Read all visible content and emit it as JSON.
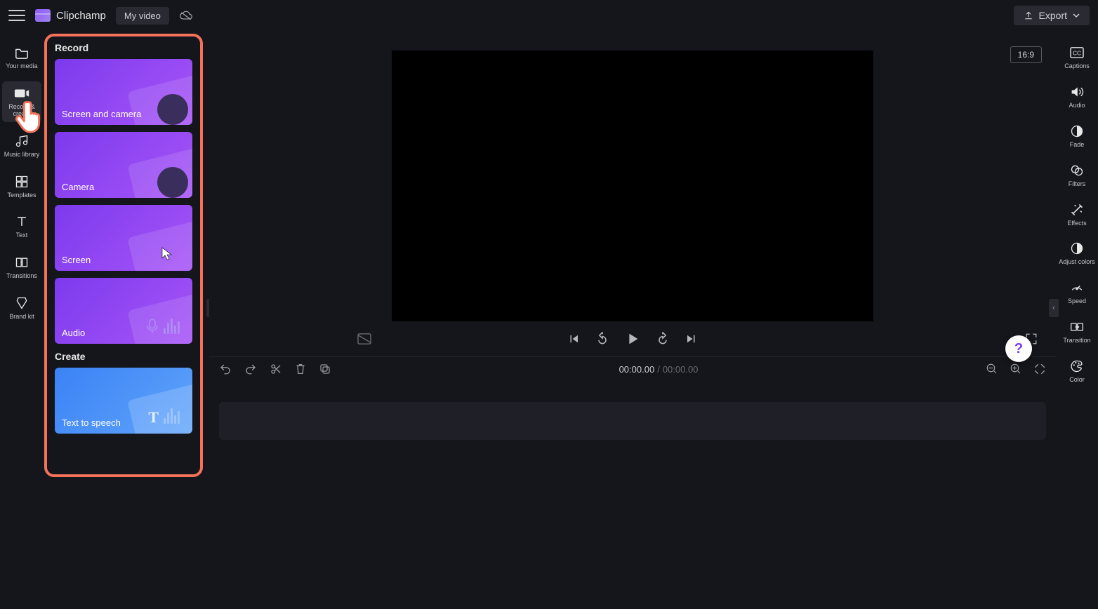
{
  "header": {
    "brand": "Clipchamp",
    "project": "My video",
    "export": "Export"
  },
  "left_rail": [
    {
      "label": "Your media",
      "icon": "folder"
    },
    {
      "label": "Record & create",
      "icon": "camera",
      "active": true
    },
    {
      "label": "Music library",
      "icon": "music"
    },
    {
      "label": "Templates",
      "icon": "templates"
    },
    {
      "label": "Text",
      "icon": "text"
    },
    {
      "label": "Transitions",
      "icon": "transitions"
    },
    {
      "label": "Brand kit",
      "icon": "brandkit"
    }
  ],
  "panel": {
    "section_record": "Record",
    "section_create": "Create",
    "cards": {
      "screen_camera": "Screen and camera",
      "camera": "Camera",
      "screen": "Screen",
      "audio": "Audio",
      "tts": "Text to speech"
    }
  },
  "preview": {
    "aspect": "16:9"
  },
  "timecode": {
    "current": "00:00.00",
    "total": "00:00.00"
  },
  "right_rail": [
    {
      "label": "Captions",
      "icon": "captions"
    },
    {
      "label": "Audio",
      "icon": "audio"
    },
    {
      "label": "Fade",
      "icon": "fade"
    },
    {
      "label": "Filters",
      "icon": "filters"
    },
    {
      "label": "Effects",
      "icon": "effects"
    },
    {
      "label": "Adjust colors",
      "icon": "adjust"
    },
    {
      "label": "Speed",
      "icon": "speed"
    },
    {
      "label": "Transition",
      "icon": "transition"
    },
    {
      "label": "Color",
      "icon": "color"
    }
  ]
}
